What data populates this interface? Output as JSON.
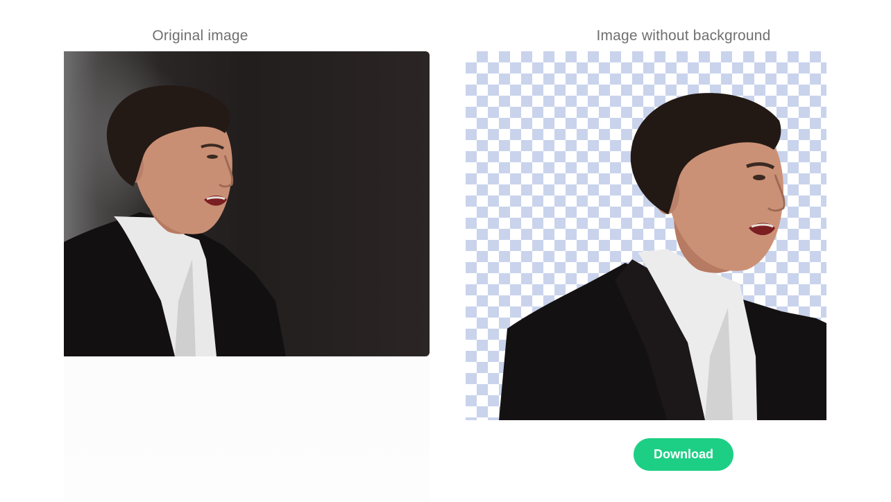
{
  "panels": {
    "original": {
      "title": "Original image"
    },
    "result": {
      "title": "Image without background"
    }
  },
  "actions": {
    "download_label": "Download"
  },
  "colors": {
    "title_text": "#6f6f6f",
    "download_button": "#1dcf85",
    "checker_light": "#ffffff",
    "checker_dark": "#c9d3ec"
  }
}
